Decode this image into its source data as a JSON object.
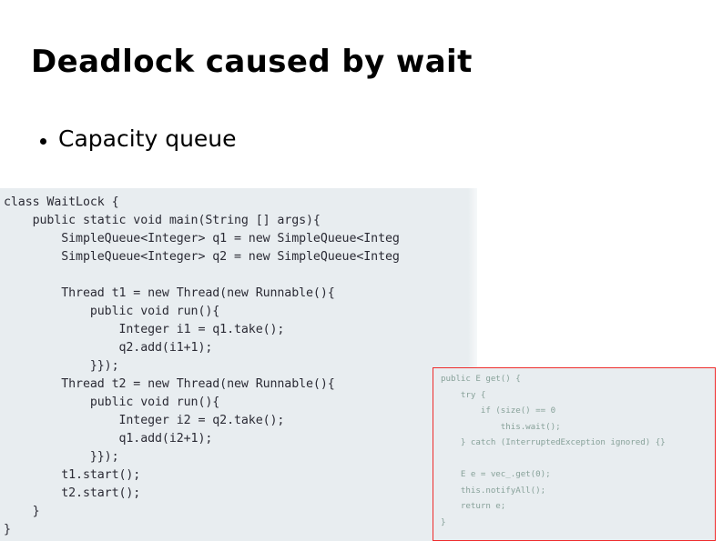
{
  "slide": {
    "title": "Deadlock caused by wait",
    "bullets": [
      {
        "marker": "bullet-dot",
        "text": "Capacity queue"
      }
    ]
  },
  "main_code": {
    "name": "WaitLock deadlock example",
    "language": "java",
    "background_color": "#e8edf0",
    "text_color": "#2b2b35",
    "clipped_right_edge": true,
    "lines": [
      "class WaitLock {",
      "    public static void main(String [] args){",
      "        SimpleQueue<Integer> q1 = new SimpleQueue<Integ",
      "        SimpleQueue<Integer> q2 = new SimpleQueue<Integ",
      "",
      "        Thread t1 = new Thread(new Runnable(){",
      "            public void run(){",
      "                Integer i1 = q1.take();",
      "                q2.add(i1+1);",
      "            }});",
      "        Thread t2 = new Thread(new Runnable(){",
      "            public void run(){",
      "                Integer i2 = q2.take();",
      "                q1.add(i2+1);",
      "            }});",
      "        t1.start();",
      "        t2.start();",
      "    }",
      "}"
    ],
    "text": "class WaitLock {\n    public static void main(String [] args){\n        SimpleQueue<Integer> q1 = new SimpleQueue<Integ\n        SimpleQueue<Integer> q2 = new SimpleQueue<Integ\n\n        Thread t1 = new Thread(new Runnable(){\n            public void run(){\n                Integer i1 = q1.take();\n                q2.add(i1+1);\n            }});\n        Thread t2 = new Thread(new Runnable(){\n            public void run(){\n                Integer i2 = q2.take();\n                q1.add(i2+1);\n            }});\n        t1.start();\n        t2.start();\n    }\n}"
  },
  "inset_code": {
    "name": "SimpleQueue get() implementation",
    "language": "java",
    "background_color": "#e8edf0",
    "border_color": "#ee2b2b",
    "text_color": "#7f9b92",
    "lines": [
      "public E get() {",
      "    try {",
      "        if (size() == 0",
      "            this.wait();",
      "    } catch (InterruptedException ignored) {}",
      "",
      "    E e = vec_.get(0);",
      "    this.notifyAll();",
      "    return e;",
      "}"
    ],
    "text": "public E get() {\n    try {\n        if (size() == 0\n            this.wait();\n    } catch (InterruptedException ignored) {}\n\n    E e = vec_.get(0);\n    this.notifyAll();\n    return e;\n}"
  }
}
